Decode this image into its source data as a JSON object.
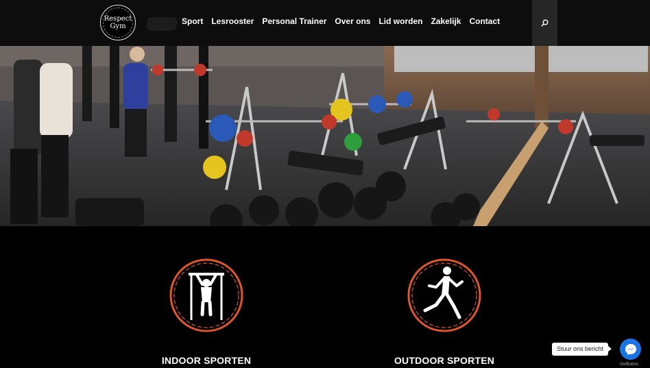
{
  "header": {
    "logo": {
      "line1": "Respect",
      "line2": "Gym"
    },
    "nav": [
      {
        "label": "Sport"
      },
      {
        "label": "Lesrooster"
      },
      {
        "label": "Personal Trainer"
      },
      {
        "label": "Over ons"
      },
      {
        "label": "Lid worden"
      },
      {
        "label": "Zakelijk"
      },
      {
        "label": "Contact"
      }
    ],
    "search_icon": "search-icon"
  },
  "hero": {
    "image": "gym-floor-photo"
  },
  "features": [
    {
      "title": "INDOOR SPORTEN",
      "icon": "pullup-icon"
    },
    {
      "title": "OUTDOOR SPORTEN",
      "icon": "runner-icon"
    }
  ],
  "chat": {
    "bubble_text": "Stuur ons bericht",
    "brand": "GetButton",
    "icon": "messenger-icon"
  },
  "colors": {
    "header_bg": "#0d0d0d",
    "search_bg": "#262626",
    "accent_orange": "#e0552b",
    "messenger_blue": "#1b74e4"
  }
}
